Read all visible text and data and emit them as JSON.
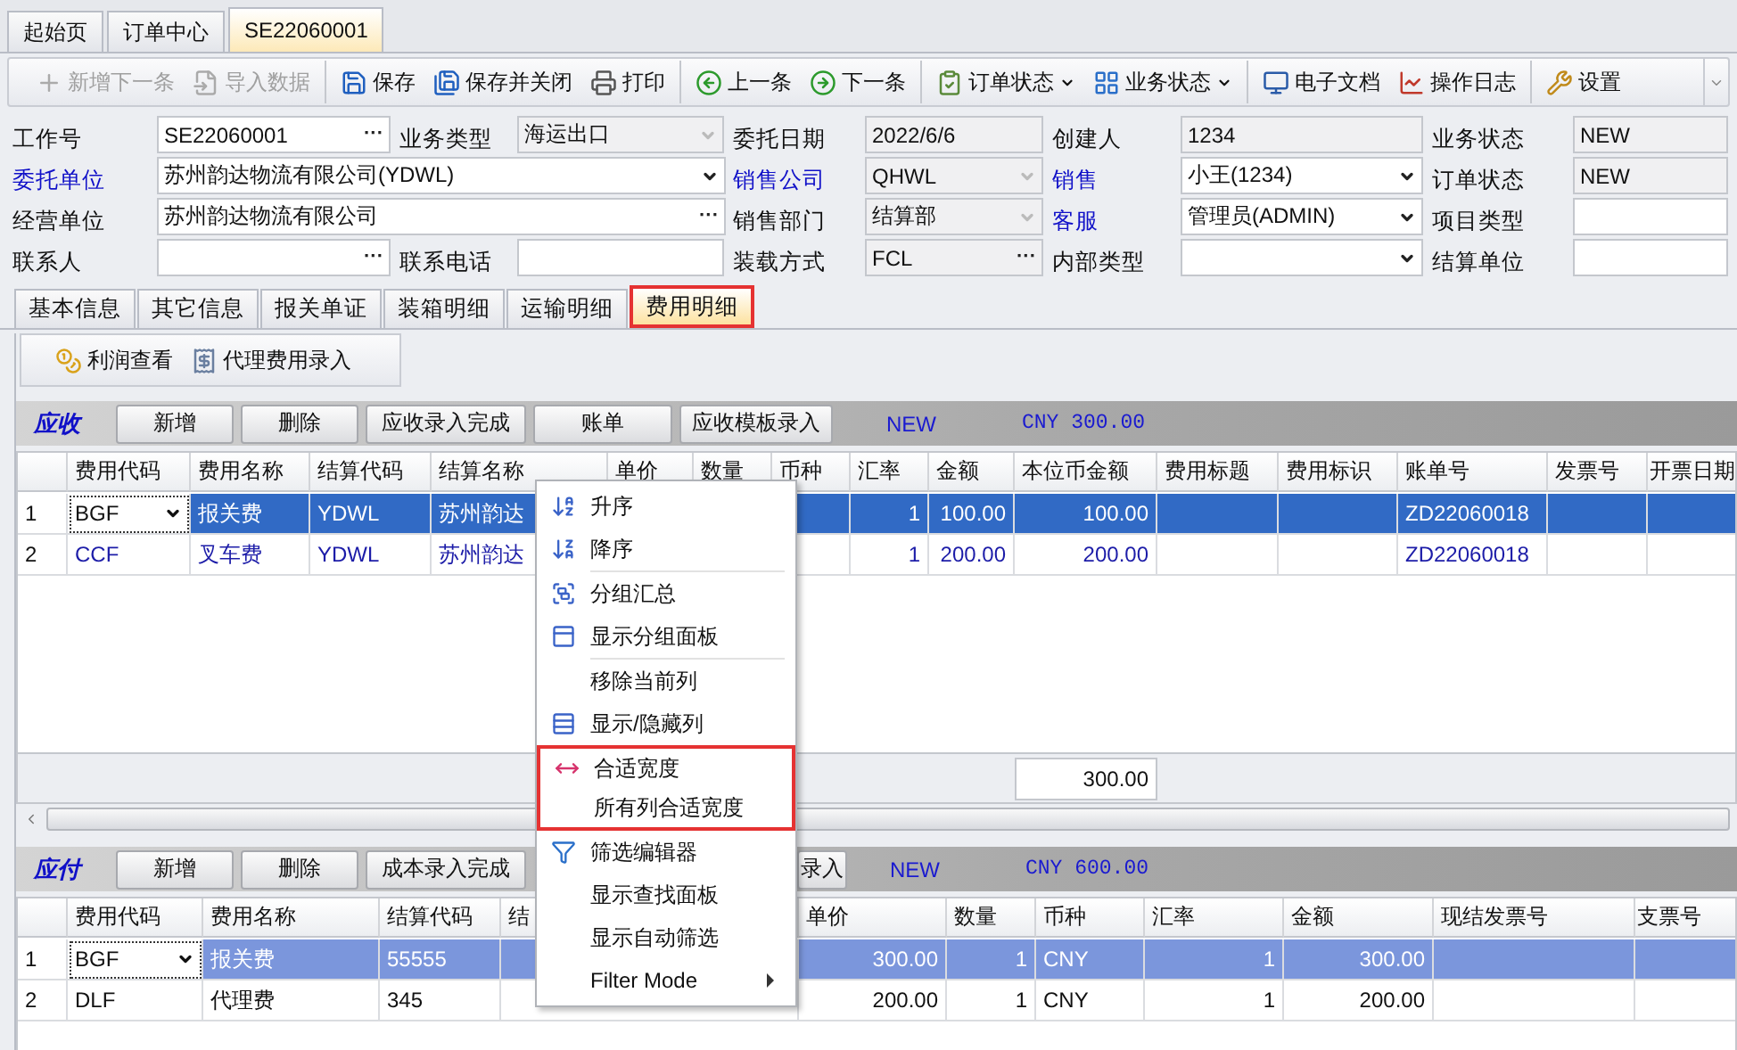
{
  "doc_tabs": [
    {
      "label": "起始页",
      "selected": false
    },
    {
      "label": "订单中心",
      "selected": false
    },
    {
      "label": "SE22060001",
      "selected": true
    }
  ],
  "toolbar": [
    {
      "label": "新增下一条",
      "disabled": true,
      "dropdown": false,
      "separator_before": false
    },
    {
      "label": "导入数据",
      "disabled": true,
      "dropdown": false,
      "separator_before": false
    },
    {
      "label": "保存",
      "disabled": false,
      "dropdown": false,
      "separator_before": true
    },
    {
      "label": "保存并关闭",
      "disabled": false,
      "dropdown": false,
      "separator_before": false
    },
    {
      "label": "打印",
      "disabled": false,
      "dropdown": false,
      "separator_before": false
    },
    {
      "label": "上一条",
      "disabled": false,
      "dropdown": false,
      "separator_before": true
    },
    {
      "label": "下一条",
      "disabled": false,
      "dropdown": false,
      "separator_before": false
    },
    {
      "label": "订单状态",
      "disabled": false,
      "dropdown": true,
      "separator_before": true
    },
    {
      "label": "业务状态",
      "disabled": false,
      "dropdown": true,
      "separator_before": false
    },
    {
      "label": "电子文档",
      "disabled": false,
      "dropdown": false,
      "separator_before": true
    },
    {
      "label": "操作日志",
      "disabled": false,
      "dropdown": false,
      "separator_before": false
    },
    {
      "label": "设置",
      "disabled": false,
      "dropdown": false,
      "separator_before": true
    }
  ],
  "form_rows": [
    [
      {
        "label": "工作号",
        "link": false,
        "wide": false,
        "value": "SE22060001",
        "button": "···",
        "dropdown": false,
        "readonly": false
      },
      {
        "label": "业务类型",
        "link": false,
        "wide": false,
        "value": "海运出口",
        "dropdown": true,
        "readonly": true
      },
      {
        "label": "委托日期",
        "link": false,
        "wide": false,
        "value": "2022/6/6",
        "dropdown": false,
        "readonly": true
      },
      {
        "label": "创建人",
        "link": false,
        "wide": false,
        "value": "1234",
        "dropdown": false,
        "readonly": true
      },
      {
        "label": "业务状态",
        "link": false,
        "wide": false,
        "value": "NEW",
        "dropdown": false,
        "readonly": true
      }
    ],
    [
      {
        "label": "委托单位",
        "link": true,
        "wide": true,
        "value": "苏州韵达物流有限公司(YDWL)",
        "dropdown": true,
        "readonly": false
      },
      {
        "label": "销售公司",
        "link": true,
        "wide": false,
        "value": "QHWL",
        "dropdown": true,
        "readonly": true
      },
      {
        "label": "销售",
        "link": true,
        "wide": false,
        "value": "小王(1234)",
        "dropdown": true,
        "readonly": false
      },
      {
        "label": "订单状态",
        "link": false,
        "wide": false,
        "value": "NEW",
        "dropdown": false,
        "readonly": true
      }
    ],
    [
      {
        "label": "经营单位",
        "link": false,
        "wide": true,
        "value": "苏州韵达物流有限公司",
        "button": "···",
        "dropdown": false,
        "readonly": false
      },
      {
        "label": "销售部门",
        "link": false,
        "wide": false,
        "value": "结算部",
        "dropdown": true,
        "readonly": true
      },
      {
        "label": "客服",
        "link": true,
        "wide": false,
        "value": "管理员(ADMIN)",
        "dropdown": true,
        "readonly": false
      },
      {
        "label": "项目类型",
        "link": false,
        "wide": false,
        "dropdown": false,
        "readonly": false
      }
    ],
    [
      {
        "label": "联系人",
        "link": false,
        "wide": false,
        "button": "···",
        "dropdown": false,
        "readonly": false
      },
      {
        "label": "联系电话",
        "link": false,
        "wide": false,
        "dropdown": false,
        "readonly": false
      },
      {
        "label": "装载方式",
        "link": false,
        "wide": false,
        "value": "FCL",
        "button": "···",
        "dropdown": false,
        "readonly": true
      },
      {
        "label": "内部类型",
        "link": false,
        "wide": false,
        "dropdown": true,
        "readonly": false
      },
      {
        "label": "结算单位",
        "link": false,
        "wide": false,
        "dropdown": false,
        "readonly": false
      }
    ]
  ],
  "section_tabs": [
    {
      "label": "基本信息",
      "selected": false,
      "highlighted": false
    },
    {
      "label": "其它信息",
      "selected": false,
      "highlighted": false
    },
    {
      "label": "报关单证",
      "selected": false,
      "highlighted": false
    },
    {
      "label": "装箱明细",
      "selected": false,
      "highlighted": false
    },
    {
      "label": "运输明细",
      "selected": false,
      "highlighted": false
    },
    {
      "label": "费用明细",
      "selected": true,
      "highlighted": true
    }
  ],
  "sub_toolbar": [
    {
      "label": "利润查看"
    },
    {
      "label": "代理费用录入"
    }
  ],
  "grids": [
    {
      "title": "应收",
      "active": true,
      "buttons": [
        "新增",
        "删除",
        "应收录入完成",
        "账单",
        "应收模板录入"
      ],
      "status": "NEW",
      "total_text": "CNY 300.00",
      "columns": [
        "费用代码",
        "费用名称",
        "结算代码",
        "结算名称",
        "单价",
        "数量",
        "币种",
        "汇率",
        "金额",
        "本位币金额",
        "费用标题",
        "费用标识",
        "账单号",
        "发票号",
        "开票日期"
      ],
      "rows": [
        {
          "num": "1",
          "selected": true,
          "cells": [
            "BGF",
            "报关费",
            "YDWL",
            "苏州韵达",
            null,
            null,
            null,
            "1",
            "100.00",
            "100.00",
            null,
            null,
            "ZD22060018",
            null,
            null
          ]
        },
        {
          "num": "2",
          "selected": false,
          "cells": [
            "CCF",
            "叉车费",
            "YDWL",
            "苏州韵达",
            null,
            null,
            null,
            "1",
            "200.00",
            "200.00",
            null,
            null,
            "ZD22060018",
            null,
            null
          ]
        }
      ],
      "summary": "300.00"
    },
    {
      "title": "应付",
      "active": false,
      "buttons": [
        "新增",
        "删除",
        "成本录入完成",
        "录入"
      ],
      "status": "NEW",
      "total_text": "CNY 600.00",
      "columns": [
        "费用代码",
        "费用名称",
        "结算代码",
        "结",
        "单价",
        "数量",
        "币种",
        "汇率",
        "金额",
        "现结发票号",
        "支票号"
      ],
      "rows": [
        {
          "num": "1",
          "selected": true,
          "cells": [
            "BGF",
            "报关费",
            "55555",
            null,
            "300.00",
            "1",
            "CNY",
            "1",
            "300.00",
            null,
            null
          ]
        },
        {
          "num": "2",
          "selected": false,
          "cells": [
            "DLF",
            "代理费",
            "345",
            null,
            "200.00",
            "1",
            "CNY",
            "1",
            "200.00",
            null,
            null
          ]
        }
      ]
    }
  ],
  "context_menu": {
    "groups": [
      {
        "divided": false,
        "highlighted": false,
        "items": [
          {
            "label": "升序",
            "submenu": false
          },
          {
            "label": "降序",
            "submenu": false
          }
        ]
      },
      {
        "divided": true,
        "highlighted": false,
        "items": [
          {
            "label": "分组汇总",
            "submenu": false
          },
          {
            "label": "显示分组面板",
            "submenu": false
          }
        ]
      },
      {
        "divided": true,
        "highlighted": false,
        "items": [
          {
            "label": "移除当前列",
            "submenu": false
          },
          {
            "label": "显示/隐藏列",
            "submenu": false
          }
        ]
      },
      {
        "divided": false,
        "highlighted": true,
        "items": [
          {
            "label": "合适宽度",
            "submenu": false
          },
          {
            "label": "所有列合适宽度",
            "submenu": false
          }
        ]
      },
      {
        "divided": false,
        "highlighted": false,
        "items": [
          {
            "label": "筛选编辑器",
            "submenu": false
          },
          {
            "label": "显示查找面板",
            "submenu": false
          },
          {
            "label": "显示自动筛选",
            "submenu": false
          },
          {
            "label": "Filter Mode",
            "submenu": true
          }
        ]
      }
    ]
  }
}
